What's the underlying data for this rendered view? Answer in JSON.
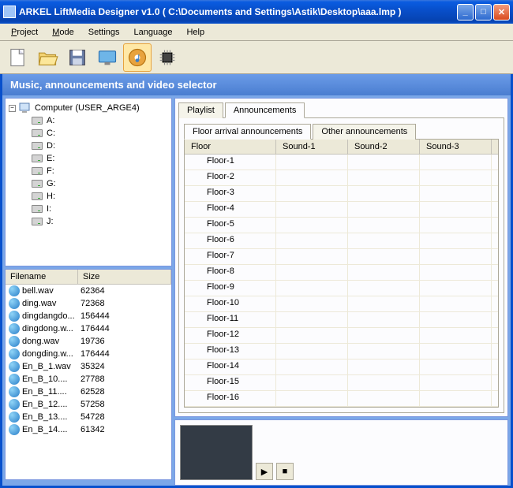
{
  "window": {
    "title": "ARKEL LiftMedia Designer v1.0     ( C:\\Documents and Settings\\Astik\\Desktop\\aaa.lmp )"
  },
  "menu": {
    "project": "Project",
    "mode": "Mode",
    "settings": "Settings",
    "language": "Language",
    "help": "Help"
  },
  "section_title": "Music, announcements and video selector",
  "tree": {
    "root": "Computer (USER_ARGE4)",
    "drives": [
      "A:",
      "C:",
      "D:",
      "E:",
      "F:",
      "G:",
      "H:",
      "I:",
      "J:"
    ]
  },
  "file_header": {
    "filename": "Filename",
    "size": "Size"
  },
  "files": [
    {
      "name": "bell.wav",
      "size": "62364"
    },
    {
      "name": "ding.wav",
      "size": "72368"
    },
    {
      "name": "dingdangdo...",
      "size": "156444"
    },
    {
      "name": "dingdong.w...",
      "size": "176444"
    },
    {
      "name": "dong.wav",
      "size": "19736"
    },
    {
      "name": "dongding.w...",
      "size": "176444"
    },
    {
      "name": "En_B_1.wav",
      "size": "35324"
    },
    {
      "name": "En_B_10....",
      "size": "27788"
    },
    {
      "name": "En_B_11....",
      "size": "62528"
    },
    {
      "name": "En_B_12....",
      "size": "57258"
    },
    {
      "name": "En_B_13....",
      "size": "54728"
    },
    {
      "name": "En_B_14....",
      "size": "61342"
    }
  ],
  "tabs": {
    "playlist": "Playlist",
    "announcements": "Announcements"
  },
  "subtabs": {
    "floor_arrival": "Floor arrival announcements",
    "other": "Other announcements"
  },
  "grid": {
    "headers": {
      "floor": "Floor",
      "s1": "Sound-1",
      "s2": "Sound-2",
      "s3": "Sound-3"
    },
    "rows": [
      "Floor-1",
      "Floor-2",
      "Floor-3",
      "Floor-4",
      "Floor-5",
      "Floor-6",
      "Floor-7",
      "Floor-8",
      "Floor-9",
      "Floor-10",
      "Floor-11",
      "Floor-12",
      "Floor-13",
      "Floor-14",
      "Floor-15",
      "Floor-16"
    ]
  }
}
